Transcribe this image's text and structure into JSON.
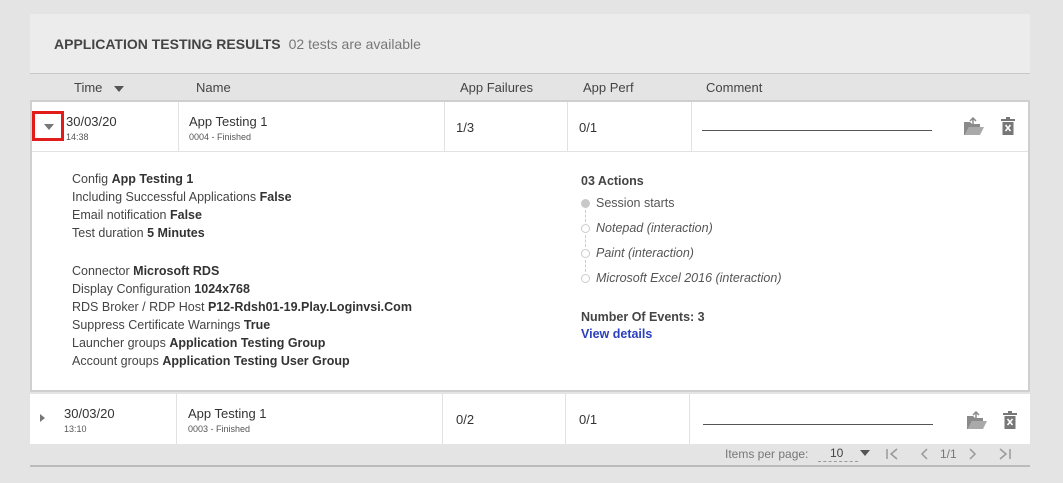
{
  "header": {
    "title": "APPLICATION TESTING RESULTS",
    "subtitle": "02 tests are available"
  },
  "columns": {
    "time": "Time",
    "name": "Name",
    "app_failures": "App Failures",
    "app_perf": "App Perf",
    "comment": "Comment"
  },
  "rows": [
    {
      "date": "30/03/20",
      "time": "14:38",
      "name": "App Testing 1",
      "status": "0004 - Finished",
      "app_failures": "1/3",
      "app_perf": "0/1",
      "expanded": true
    },
    {
      "date": "30/03/20",
      "time": "13:10",
      "name": "App Testing 1",
      "status": "0003 - Finished",
      "app_failures": "0/2",
      "app_perf": "0/1",
      "expanded": false
    }
  ],
  "details": {
    "config": {
      "label": "Config",
      "value": "App Testing 1"
    },
    "including": {
      "label": "Including Successful Applications",
      "value": "False"
    },
    "email": {
      "label": "Email notification",
      "value": "False"
    },
    "duration": {
      "label": "Test duration",
      "value": "5 Minutes"
    },
    "connector": {
      "label": "Connector",
      "value": "Microsoft RDS"
    },
    "display": {
      "label": "Display Configuration",
      "value": "1024x768"
    },
    "rds": {
      "label": "RDS Broker / RDP Host",
      "value": "P12-Rdsh01-19.Play.Loginvsi.Com"
    },
    "suppress": {
      "label": "Suppress Certificate Warnings",
      "value": "True"
    },
    "launcher": {
      "label": "Launcher groups",
      "value": "Application Testing Group"
    },
    "account": {
      "label": "Account groups",
      "value": "Application Testing User Group"
    },
    "actions_title": "03 Actions",
    "actions": [
      "Session starts",
      "Notepad (interaction)",
      "Paint (interaction)",
      "Microsoft Excel 2016 (interaction)"
    ],
    "events": "Number Of Events: 3",
    "view_details": "View details"
  },
  "pager": {
    "items_label": "Items per page:",
    "items_value": "10",
    "range": "1/1"
  },
  "icons": {
    "folder": "folder-open-icon",
    "delete": "trash-icon"
  }
}
